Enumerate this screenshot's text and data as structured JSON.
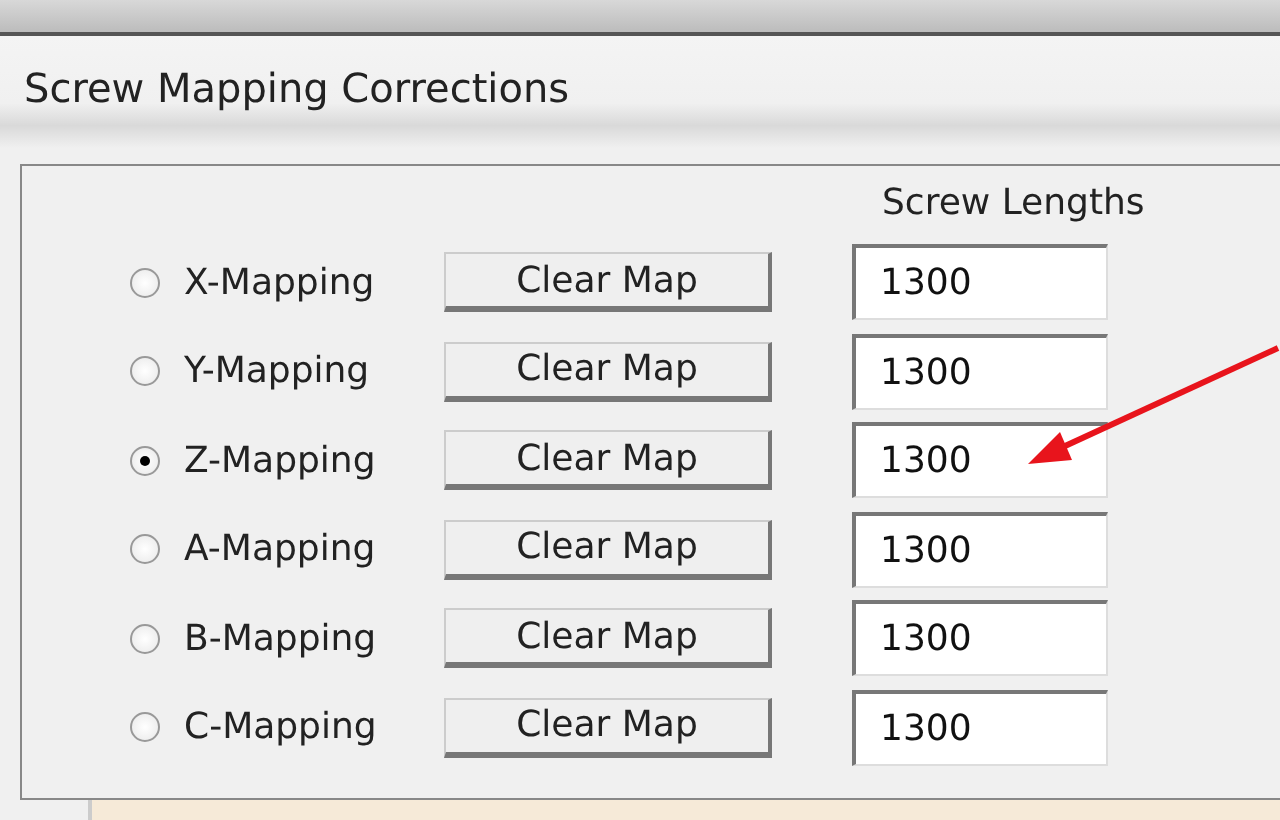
{
  "title": "Screw Mapping Corrections",
  "column_header": "Screw Lengths",
  "mappings": [
    {
      "label": "X-Mapping",
      "selected": false,
      "button": "Clear Map",
      "length": "1300"
    },
    {
      "label": "Y-Mapping",
      "selected": false,
      "button": "Clear Map",
      "length": "1300"
    },
    {
      "label": "Z-Mapping",
      "selected": true,
      "button": "Clear Map",
      "length": "1300"
    },
    {
      "label": "A-Mapping",
      "selected": false,
      "button": "Clear Map",
      "length": "1300"
    },
    {
      "label": "B-Mapping",
      "selected": false,
      "button": "Clear Map",
      "length": "1300"
    },
    {
      "label": "C-Mapping",
      "selected": false,
      "button": "Clear Map",
      "length": "1300"
    }
  ]
}
